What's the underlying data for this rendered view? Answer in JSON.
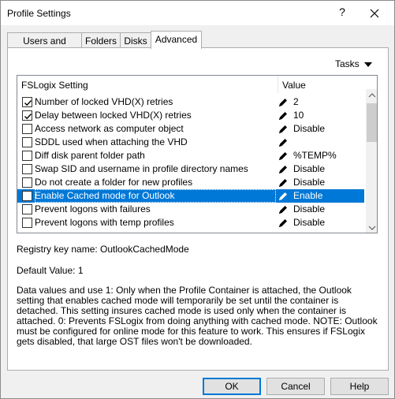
{
  "window": {
    "title": "Profile Settings",
    "help_glyph": "?"
  },
  "tabs": [
    {
      "label": "Users and Groups"
    },
    {
      "label": "Folders"
    },
    {
      "label": "Disks"
    },
    {
      "label": "Advanced"
    }
  ],
  "tasks": {
    "label": "Tasks"
  },
  "list": {
    "header_setting": "FSLogix Setting",
    "header_value": "Value",
    "rows": [
      {
        "label": "Number of locked VHD(X) retries",
        "checked": true,
        "value": "2",
        "selected": false
      },
      {
        "label": "Delay between locked VHD(X) retries",
        "checked": true,
        "value": "10",
        "selected": false
      },
      {
        "label": "Access network as computer object",
        "checked": false,
        "value": "Disable",
        "selected": false
      },
      {
        "label": "SDDL used when attaching the VHD",
        "checked": false,
        "value": "",
        "selected": false
      },
      {
        "label": "Diff disk parent folder path",
        "checked": false,
        "value": "%TEMP%",
        "selected": false
      },
      {
        "label": "Swap SID and username in profile directory names",
        "checked": false,
        "value": "Disable",
        "selected": false
      },
      {
        "label": "Do not create a folder for new profiles",
        "checked": false,
        "value": "Disable",
        "selected": false
      },
      {
        "label": "Enable Cached mode for Outlook",
        "checked": false,
        "value": "Enable",
        "selected": true
      },
      {
        "label": "Prevent logons with failures",
        "checked": false,
        "value": "Disable",
        "selected": false
      },
      {
        "label": "Prevent logons with temp profiles",
        "checked": false,
        "value": "Disable",
        "selected": false
      }
    ]
  },
  "details": {
    "registry_key": "Registry key name: OutlookCachedMode",
    "default_value": "Default Value: 1",
    "description": "Data values and use 1: Only when the Profile Container is attached, the Outlook setting that enables cached mode will temporarily be set until the container is detached. This setting insures cached mode is used only when the container is attached. 0: Prevents FSLogix from doing anything with cached mode. NOTE: Outlook must be configured for online mode for this feature to work. This ensures if FSLogix gets disabled, that large OST files won't be downloaded."
  },
  "buttons": {
    "ok": "OK",
    "cancel": "Cancel",
    "help": "Help"
  },
  "colors": {
    "selection": "#0078d7",
    "dialog_bg": "#f0f0f0",
    "default_button_border": "#0078d7"
  }
}
